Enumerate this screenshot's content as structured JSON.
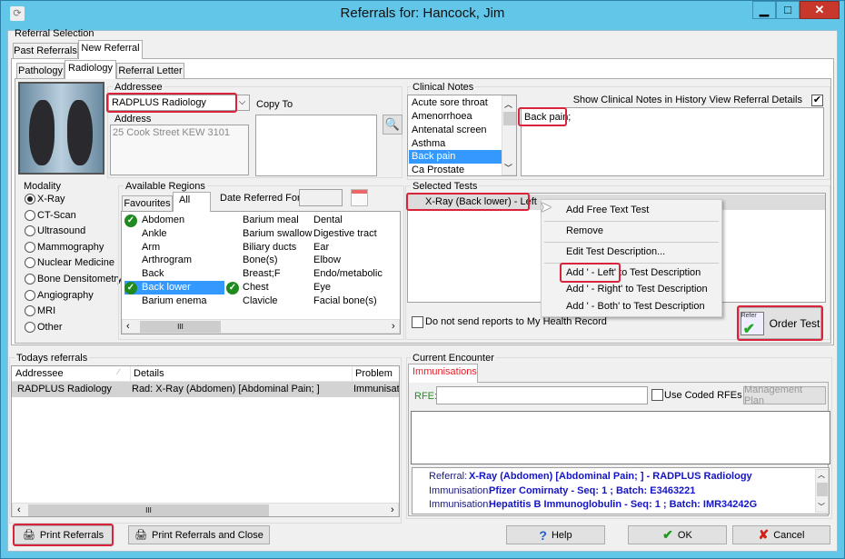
{
  "window": {
    "title": "Referrals for: Hancock, Jim",
    "minimize": "▁",
    "maximize": "□",
    "close": "✕"
  },
  "referral_selection": {
    "label": "Referral Selection",
    "tabs": [
      "Past Referrals",
      "New Referral"
    ]
  },
  "subtabs": [
    "Pathology",
    "Radiology",
    "Referral Letter"
  ],
  "addressee": {
    "label": "Addressee",
    "value": "RADPLUS Radiology",
    "address_label": "Address",
    "address": "25 Cook Street KEW  3101",
    "copy_to_label": "Copy To"
  },
  "clinical_notes": {
    "label": "Clinical Notes",
    "items": [
      "Acute sore throat",
      "Amenorrhoea",
      "Antenatal screen",
      "Asthma",
      "Back pain",
      "Ca Prostate"
    ],
    "selected": "Back pain",
    "show_label": "Show Clinical Notes in History View Referral Details",
    "show_checked": true,
    "text": "Back pain;"
  },
  "modality": {
    "label": "Modality",
    "options": [
      "X-Ray",
      "CT-Scan",
      "Ultrasound",
      "Mammography",
      "Nuclear Medicine",
      "Bone Densitometry",
      "Angiography",
      "MRI",
      "Other"
    ],
    "selected": "X-Ray"
  },
  "regions": {
    "label": "Available Regions",
    "tabs": [
      "Favourites",
      "All"
    ],
    "active_tab": "All",
    "date_label": "Date Referred For",
    "columns": [
      [
        {
          "name": "Abdomen",
          "checked": true
        },
        {
          "name": "Ankle"
        },
        {
          "name": "Arm"
        },
        {
          "name": "Arthrogram"
        },
        {
          "name": "Back"
        },
        {
          "name": "Back lower",
          "checked": true,
          "selected": true
        },
        {
          "name": "Barium enema"
        }
      ],
      [
        {
          "name": "Barium meal"
        },
        {
          "name": "Barium swallow"
        },
        {
          "name": "Biliary ducts"
        },
        {
          "name": "Bone(s)"
        },
        {
          "name": "Breast;F"
        },
        {
          "name": "Chest",
          "checked": true
        },
        {
          "name": "Clavicle"
        }
      ],
      [
        {
          "name": "Dental"
        },
        {
          "name": "Digestive tract"
        },
        {
          "name": "Ear"
        },
        {
          "name": "Elbow"
        },
        {
          "name": "Endo/metabolic"
        },
        {
          "name": "Eye"
        },
        {
          "name": "Facial bone(s)"
        }
      ]
    ],
    "scroll_grip": "III"
  },
  "selected_tests": {
    "label": "Selected Tests",
    "items": [
      "X-Ray (Back lower) - Left"
    ]
  },
  "context_menu": [
    "Add Free Text Test",
    "Remove",
    "Edit Test Description...",
    "Add ' - Left' to Test Description",
    "Add ' - Right' to Test Description",
    "Add ' - Both' to Test Description"
  ],
  "mhr_label": "Do not send reports to My Health Record",
  "order_test": "Order Test",
  "order_icon_text": "Refer",
  "todays": {
    "label": "Todays referrals",
    "headers": [
      "Addressee",
      "Details",
      "Problem"
    ],
    "rows": [
      [
        "RADPLUS Radiology",
        "Rad: X-Ray (Abdomen) [Abdominal Pain; ]",
        "Immunisatio"
      ]
    ],
    "scroll_grip": "III"
  },
  "encounter": {
    "label": "Current Encounter",
    "tab": "Immunisations",
    "rfe_label": "RFE:",
    "rfe_value": "",
    "coded_label": "Use Coded RFEs",
    "mgmt": "Management Plan",
    "lines": [
      {
        "k": "Referral:",
        "v": "X-Ray (Abdomen) [Abdominal Pain; ] - RADPLUS Radiology"
      },
      {
        "k": "Immunisation:",
        "v": "Pfizer Comirnaty - Seq: 1 ; Batch: E3463221"
      },
      {
        "k": "Immunisation:",
        "v": "Hepatitis B Immunoglobulin - Seq: 1 ; Batch: IMR34242G"
      }
    ]
  },
  "buttons": {
    "print": "Print Referrals",
    "print_close": "Print Referrals and Close",
    "help": "Help",
    "ok": "OK",
    "cancel": "Cancel"
  },
  "colors": {
    "title_bar": "#62c6e8",
    "highlight": "#3399ff",
    "annotation": "#d9233a",
    "encounter_tab": "#e0202a",
    "rfe_label": "#2a8a2a",
    "link_blue": "#1414c8"
  }
}
